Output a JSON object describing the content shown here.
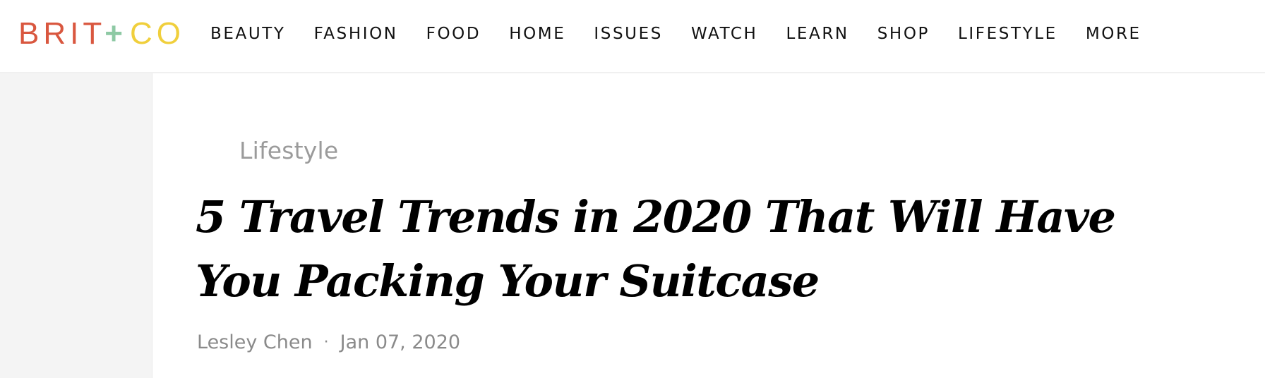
{
  "header": {
    "logo": {
      "part1": "BRIT",
      "plus": "+",
      "part2": "CO"
    },
    "nav": [
      {
        "label": "BEAUTY"
      },
      {
        "label": "FASHION"
      },
      {
        "label": "FOOD"
      },
      {
        "label": "HOME"
      },
      {
        "label": "ISSUES"
      },
      {
        "label": "WATCH"
      },
      {
        "label": "LEARN"
      },
      {
        "label": "SHOP"
      },
      {
        "label": "LIFESTYLE"
      },
      {
        "label": "MORE"
      }
    ]
  },
  "article": {
    "category": "Lifestyle",
    "title": "5 Travel Trends in 2020 That Will Have You Packing Your Suitcase",
    "author": "Lesley Chen",
    "separator": "·",
    "date": "Jan 07, 2020"
  },
  "colors": {
    "logo_red": "#d9573f",
    "logo_green": "#8ec9a4",
    "logo_yellow": "#f0cf3c",
    "gutter": "#f4f4f4",
    "meta_gray": "#8a8a8a"
  }
}
